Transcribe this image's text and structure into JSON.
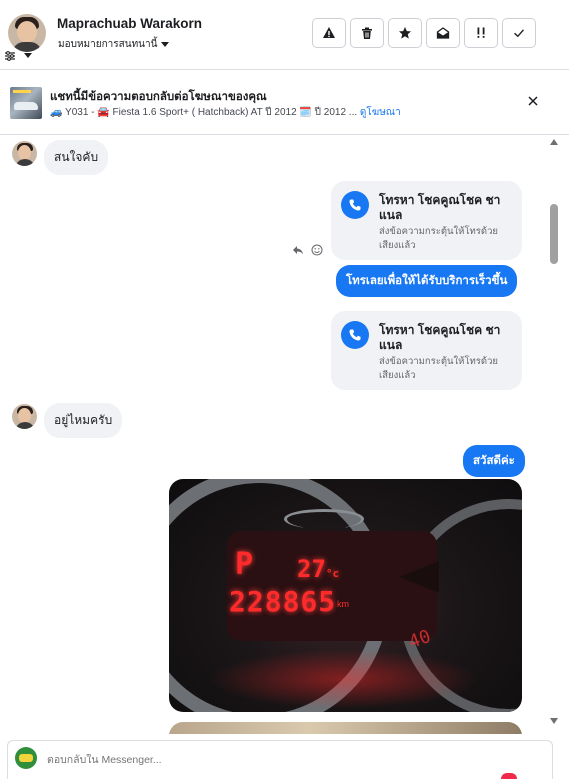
{
  "header": {
    "contact_name": "Maprachuab Warakorn",
    "assign_label": "มอบหมายการสนทนานี้",
    "toolbar": [
      {
        "name": "spam-button",
        "icon": "warning-icon"
      },
      {
        "name": "delete-button",
        "icon": "trash-icon"
      },
      {
        "name": "star-button",
        "icon": "star-icon"
      },
      {
        "name": "mark-unread-button",
        "icon": "envelope-open-icon"
      },
      {
        "name": "follow-up-button",
        "icon": "exclamation-icon"
      },
      {
        "name": "done-button",
        "icon": "check-icon"
      }
    ]
  },
  "ad": {
    "title": "แชทนี้มีข้อความตอบกลับต่อโฆษณาของคุณ",
    "subtitle": "🚙 Y031 - 🚘 Fiesta 1.6 Sport+ ( Hatchback) AT ปี 2012 🗓️ ปี 2012 ...",
    "link": "ดูโฆษณา"
  },
  "messages": {
    "m1": "สนใจคับ",
    "call1_title": "โทรหา โชคคูณโชค ชาแนล",
    "call1_sub": "ส่งข้อความกระตุ้นให้โทรด้วยเสียงแล้ว",
    "m2": "โทรเลยเพื่อให้ได้รับบริการเร็วขึ้น",
    "call2_title": "โทรหา โชคคูณโชค ชาแนล",
    "call2_sub": "ส่งข้อความกระตุ้นให้โทรด้วยเสียงแล้ว",
    "m3": "อยู่ไหมครับ",
    "m4": "สวัสดีค่ะ",
    "photo": {
      "gear": "P",
      "temp": "27",
      "temp_unit": "°c",
      "odometer": "228865",
      "odo_unit": "km"
    }
  },
  "composer": {
    "placeholder": "ตอบกลับใน Messenger..."
  },
  "colors": {
    "accent": "#1877f2",
    "bubble_in": "#f0f2f5",
    "border": "#dadde1"
  }
}
